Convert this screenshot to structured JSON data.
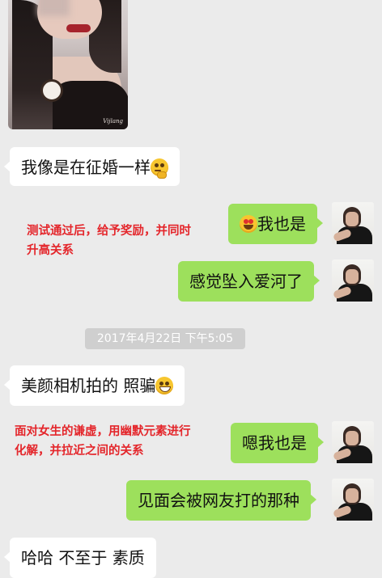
{
  "photo": {
    "signature": "Vijlang"
  },
  "messages": [
    {
      "side": "left",
      "text": "我像是在征婚一样",
      "emoji": "thinking-emoji"
    },
    {
      "side": "right",
      "text": "我也是",
      "emoji_before": "heart-eyes-emoji"
    },
    {
      "side": "right",
      "text": "感觉坠入爱河了"
    },
    {
      "side": "left",
      "text": "美颜相机拍的 照骗",
      "emoji": "grinning-emoji"
    },
    {
      "side": "right",
      "text": "嗯我也是"
    },
    {
      "side": "right",
      "text": "见面会被网友打的那种"
    },
    {
      "side": "left",
      "text": "哈哈 不至于 素质"
    }
  ],
  "timestamp": "2017年4月22日 下午5:05",
  "annotations": [
    {
      "lines": [
        "测试通过后，给予奖励，并同时",
        "升高关系"
      ]
    },
    {
      "lines": [
        "面对女生的谦虚，用幽默元素进行",
        "化解，并拉近之间的关系"
      ]
    }
  ],
  "colors": {
    "background": "#ebebeb",
    "sent_bubble": "#9de05c",
    "received_bubble": "#ffffff",
    "annotation": "#e4262b"
  }
}
